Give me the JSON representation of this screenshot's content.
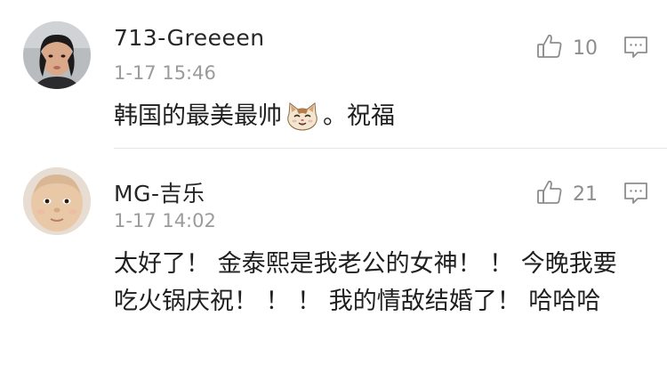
{
  "comments": [
    {
      "username": "713-Greeeen",
      "timestamp": "1-17 15:46",
      "likes": "10",
      "text_before_emoji": "韩国的最美最帅",
      "emoji": "cat-face-emoji",
      "text_after_emoji": "。祝福"
    },
    {
      "username": "MG-吉乐",
      "timestamp": "1-17 14:02",
      "likes": "21",
      "text": "太好了！ 金泰熙是我老公的女神！ ！ 今晚我要吃火锅庆祝！ ！ ！ 我的情敌结婚了！ 哈哈哈"
    }
  ],
  "icons": {
    "like": "thumbs-up-icon",
    "reply": "comment-bubble-icon"
  },
  "colors": {
    "username": "#262626",
    "meta": "#9b9b9b",
    "icon": "#8d8d8d",
    "divider": "#e6e6e6"
  }
}
